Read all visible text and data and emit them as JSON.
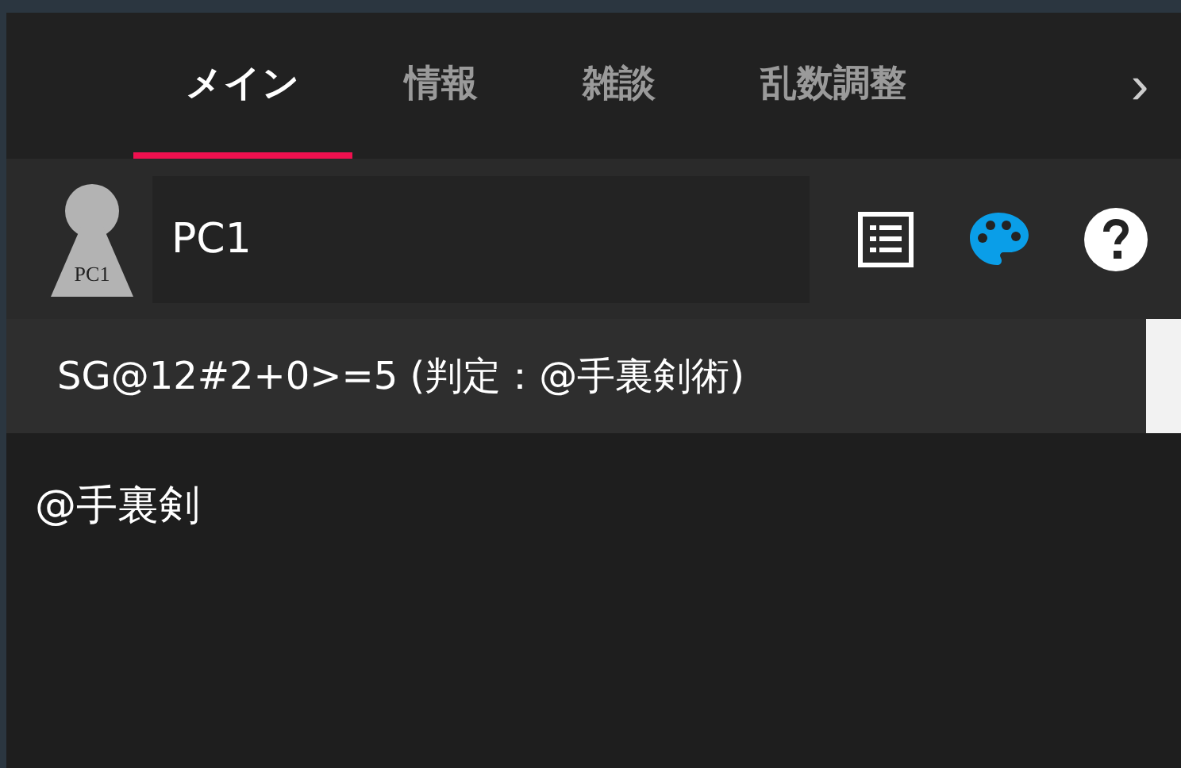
{
  "tabs": [
    {
      "label": "メイン",
      "selected": true
    },
    {
      "label": "情報",
      "selected": false
    },
    {
      "label": "雑談",
      "selected": false
    },
    {
      "label": "乱数調整",
      "selected": false
    }
  ],
  "tabs_next": "›",
  "character": {
    "avatar_label": "PC1",
    "name": "PC1"
  },
  "suggestion": {
    "text": "SG@12#2+0>=5 (判定：@手裏剣術)"
  },
  "input": {
    "value": "@手裏剣"
  }
}
